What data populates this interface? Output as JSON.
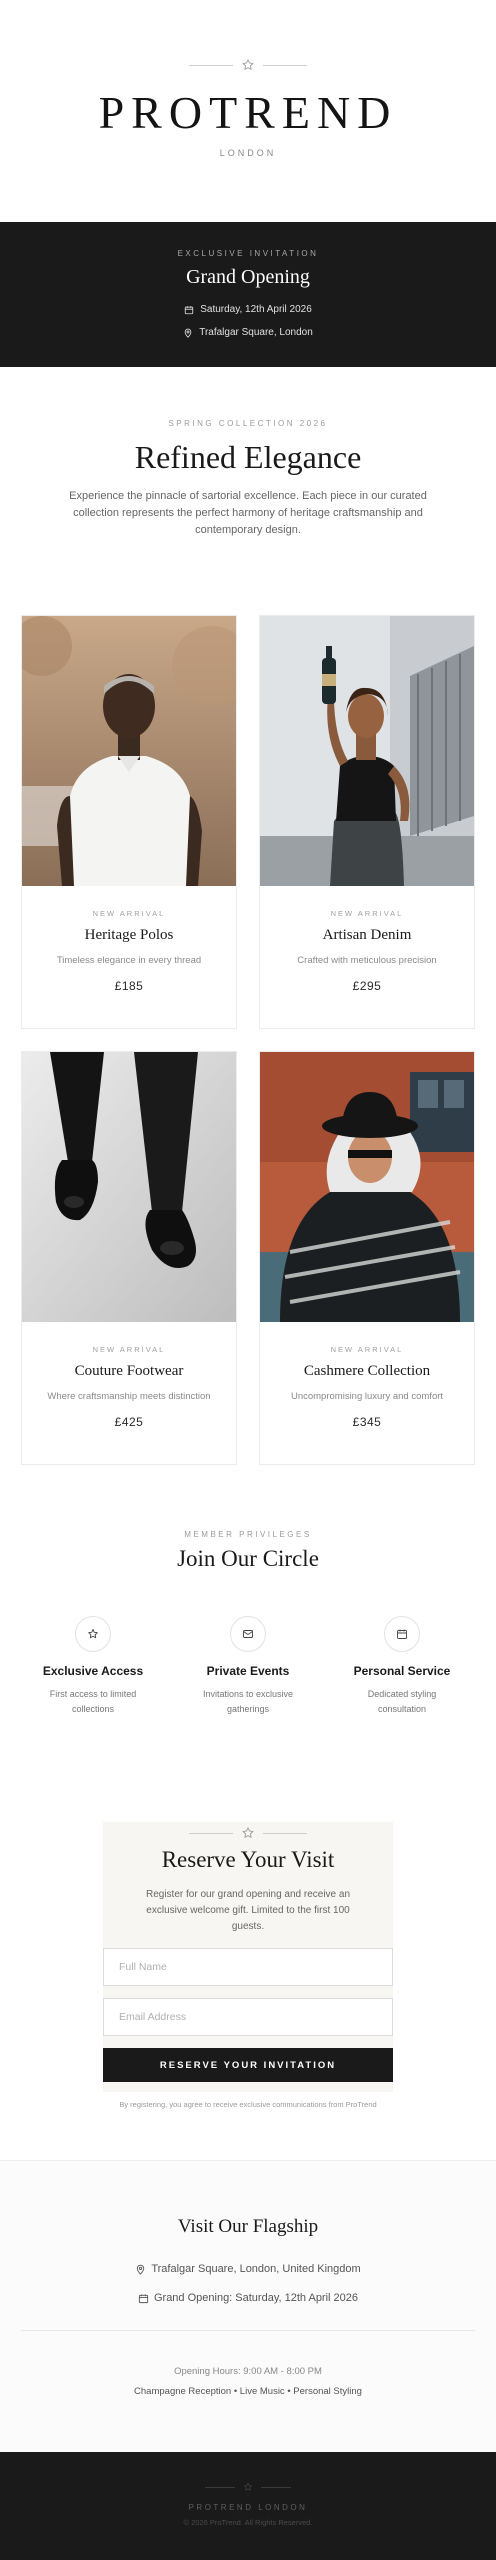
{
  "header": {
    "brand": "PROTREND",
    "location": "LONDON"
  },
  "invitation": {
    "kicker": "EXCLUSIVE INVITATION",
    "title": "Grand Opening",
    "date": "Saturday, 12th April 2026",
    "place": "Trafalgar Square, London"
  },
  "intro": {
    "kicker": "SPRING COLLECTION 2026",
    "title": "Refined Elegance",
    "description": "Experience the pinnacle of sartorial excellence. Each piece in our curated collection represents the perfect harmony of heritage craftsmanship and contemporary design."
  },
  "products": [
    {
      "tag": "NEW ARRIVAL",
      "name": "Heritage Polos",
      "tagline": "Timeless elegance in every thread",
      "price": "£185"
    },
    {
      "tag": "NEW ARRIVAL",
      "name": "Artisan Denim",
      "tagline": "Crafted with meticulous precision",
      "price": "£295"
    },
    {
      "tag": "NEW ARRIVAL",
      "name": "Couture Footwear",
      "tagline": "Where craftsmanship meets distinction",
      "price": "£425"
    },
    {
      "tag": "NEW ARRIVAL",
      "name": "Cashmere Collection",
      "tagline": "Uncompromising luxury and comfort",
      "price": "£345"
    }
  ],
  "privileges": {
    "kicker": "MEMBER PRIVILEGES",
    "title": "Join Our Circle",
    "items": [
      {
        "icon": "star-icon",
        "title": "Exclusive Access",
        "description": "First access to limited collections"
      },
      {
        "icon": "envelope-icon",
        "title": "Private Events",
        "description": "Invitations to exclusive gatherings"
      },
      {
        "icon": "calendar-icon",
        "title": "Personal Service",
        "description": "Dedicated styling consultation"
      }
    ]
  },
  "reserve": {
    "title": "Reserve Your Visit",
    "description": "Register for our grand opening and receive an exclusive welcome gift. Limited to the first 100 guests.",
    "name_placeholder": "Full Name",
    "email_placeholder": "Email Address",
    "button_label": "RESERVE YOUR INVITATION",
    "fine_print": "By registering, you agree to receive exclusive communications from ProTrend"
  },
  "flagship": {
    "title": "Visit Our Flagship",
    "address": "Trafalgar Square, London, United Kingdom",
    "opening": "Grand Opening: Saturday, 12th April 2026",
    "hours": "Opening Hours: 9:00 AM - 8:00 PM",
    "extras": "Champagne Reception • Live Music • Personal Styling"
  },
  "footer": {
    "brand": "PROTREND LONDON",
    "copyright": "© 2026 ProTrend. All Rights Reserved."
  },
  "colors": {
    "dark": "#1a1a1a",
    "cream": "#f7f6f3",
    "muted": "#888888"
  }
}
